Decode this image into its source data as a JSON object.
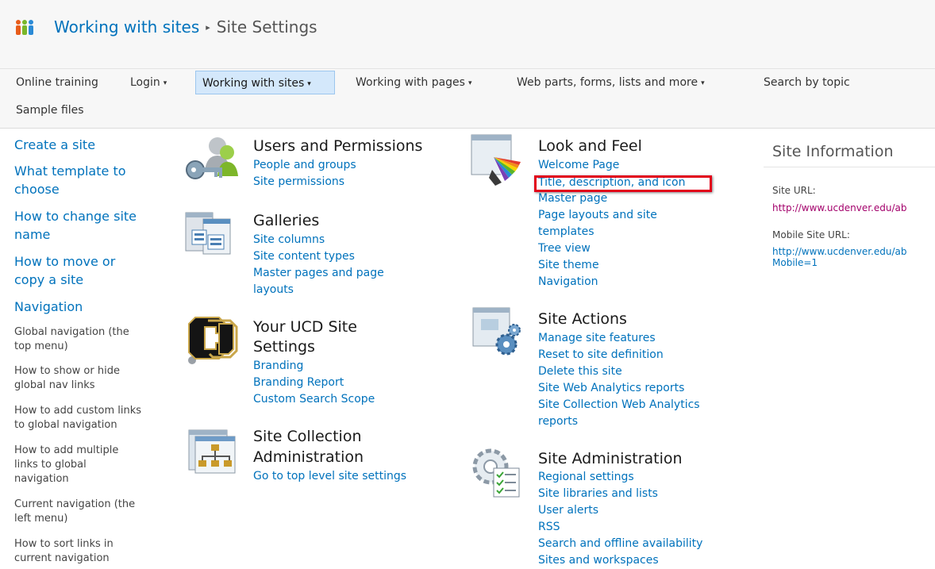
{
  "breadcrumb": {
    "site": "Working with sites",
    "separator": "▸",
    "current": "Site Settings"
  },
  "topnav": [
    {
      "label": "Online training",
      "arrow": ""
    },
    {
      "label": "Login",
      "arrow": "▾"
    },
    {
      "label": "Working with sites",
      "arrow": "▾"
    },
    {
      "label": "Working with pages",
      "arrow": "▾"
    },
    {
      "label": "Web parts, forms, lists and more",
      "arrow": "▾"
    },
    {
      "label": "Search by topic",
      "arrow": ""
    },
    {
      "label": "Sample files",
      "arrow": ""
    }
  ],
  "quicklaunch": {
    "headings": [
      "Create a site",
      "What template to",
      "choose",
      "How to change site",
      "name",
      "How to move or",
      "copy a site",
      "Navigation"
    ],
    "subitems": [
      "Global navigation (the",
      "top menu)",
      "How to show or hide",
      "global nav links",
      "How to add custom links",
      "to global navigation",
      "How to add multiple",
      "links to global",
      "navigation",
      "Current navigation (the",
      "left menu)",
      "How to sort links in",
      "current navigation"
    ]
  },
  "sections": {
    "users": {
      "title": "Users and Permissions",
      "links": [
        "People and groups",
        "Site permissions"
      ]
    },
    "galleries": {
      "title": "Galleries",
      "links": [
        "Site columns",
        "Site content types",
        "Master pages and page",
        "layouts"
      ]
    },
    "ucd": {
      "title_lines": [
        "Your UCD Site",
        "Settings"
      ],
      "links": [
        "Branding",
        "Branding Report",
        "Custom Search Scope"
      ]
    },
    "collection": {
      "title_lines": [
        "Site Collection",
        "Administration"
      ],
      "links": [
        "Go to top level site settings"
      ]
    },
    "look": {
      "title": "Look and Feel",
      "links": [
        "Welcome Page",
        "Title, description, and icon",
        "Master page",
        "Page layouts and site",
        "templates",
        "Tree view",
        "Site theme",
        "Navigation"
      ]
    },
    "actions": {
      "title": "Site Actions",
      "links": [
        "Manage site features",
        "Reset to site definition",
        "Delete this site",
        "Site Web Analytics reports",
        "Site Collection Web Analytics",
        "reports"
      ]
    },
    "admin": {
      "title": "Site Administration",
      "links": [
        "Regional settings",
        "Site libraries and lists",
        "User alerts",
        "RSS",
        "Search and offline availability",
        "Sites and workspaces"
      ]
    }
  },
  "site_info": {
    "title": "Site Information",
    "site_url_label": "Site URL:",
    "site_url": "http://www.ucdenver.edu/ab",
    "mobile_label": "Mobile Site URL:",
    "mobile_url_lines": [
      "http://www.ucdenver.edu/ab",
      "Mobile=1"
    ]
  },
  "colors": {
    "link": "#0072bc",
    "highlight": "#e2001a",
    "selected_nav": "#d4e8fb",
    "header_bg": "#f7f7f7"
  }
}
